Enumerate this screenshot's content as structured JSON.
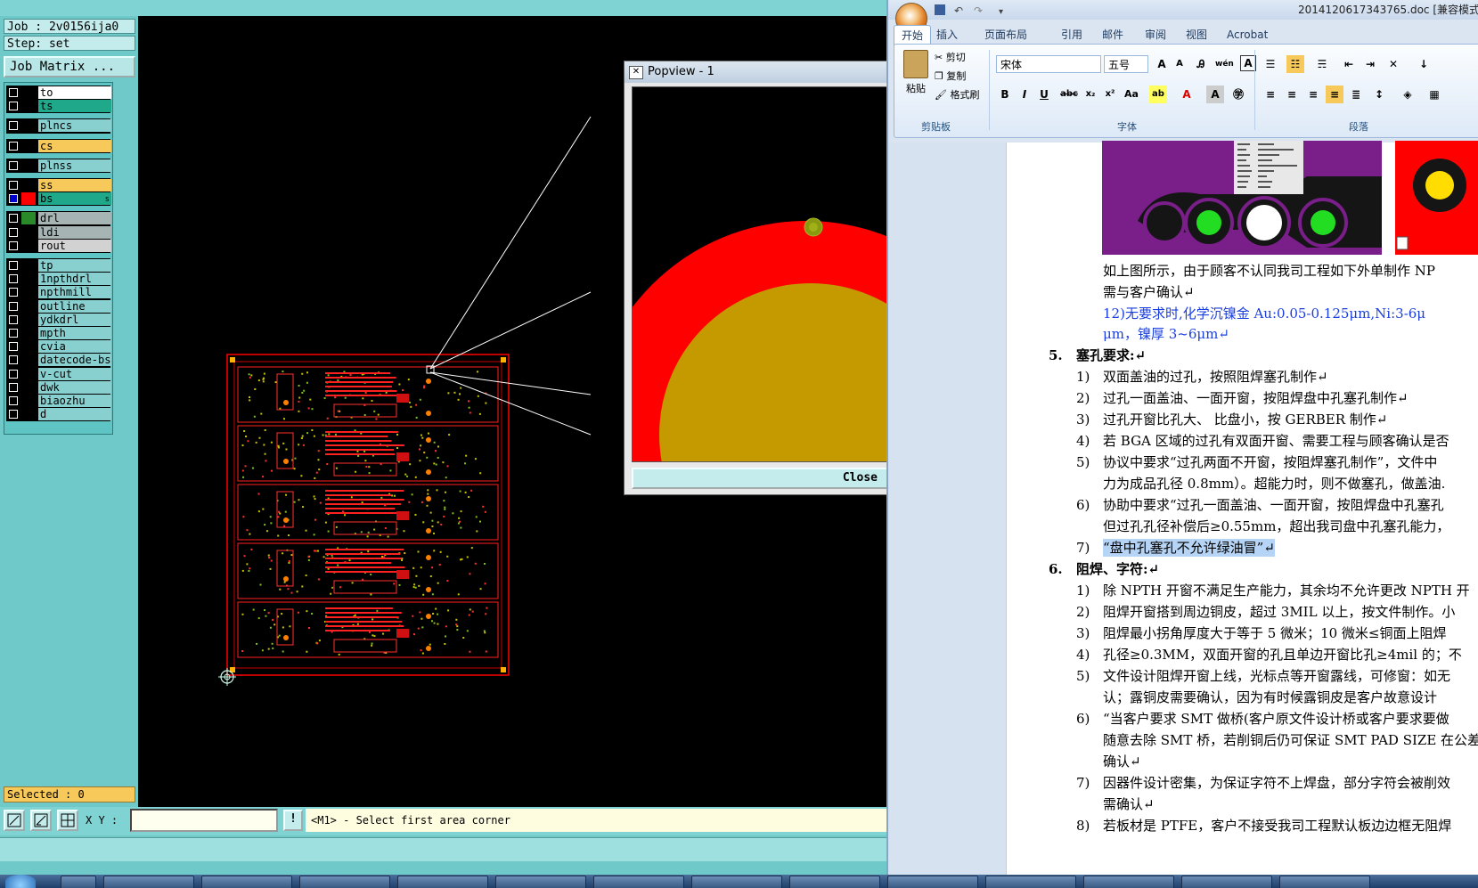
{
  "cam": {
    "job_text": "Job : 2v0156ija0",
    "step_text": "Step: set",
    "job_matrix_label": "Job Matrix ...",
    "selected_text": "Selected : 0",
    "xy_label": "X Y :",
    "xy_value": "",
    "info_button": "!",
    "prompt_text": "<M1> - Select first area corner",
    "layers": [
      {
        "name": "to",
        "swatch": "#000000",
        "color": "#ffffff"
      },
      {
        "name": "ts",
        "swatch": "#000000",
        "color": "#20a88a"
      },
      {
        "name": "plncs",
        "swatch": "#000000",
        "color": "#88d0d0"
      },
      {
        "name": "cs",
        "swatch": "#000000",
        "color": "#f7c95a"
      },
      {
        "name": "plnss",
        "swatch": "#000000",
        "color": "#88d0d0"
      },
      {
        "name": "ss",
        "swatch": "#000000",
        "color": "#f7c95a"
      },
      {
        "name": "bs",
        "swatch": "#ff0000",
        "color": "#20a88a",
        "badge": "s"
      },
      {
        "name": "drl",
        "swatch": "#2a8a2a",
        "color": "#a6b4b4"
      },
      {
        "name": "ldi",
        "swatch": "#000000",
        "color": "#a6b4b4"
      },
      {
        "name": "rout",
        "swatch": "#000000",
        "color": "#d2d2d2"
      },
      {
        "name": "tp",
        "swatch": "#000000",
        "color": "#88d0d0"
      },
      {
        "name": "1npthdrl",
        "swatch": "#000000",
        "color": "#88d0d0"
      },
      {
        "name": "npthmill",
        "swatch": "#000000",
        "color": "#88d0d0"
      },
      {
        "name": "outline",
        "swatch": "#000000",
        "color": "#88d0d0"
      },
      {
        "name": "ydkdrl",
        "swatch": "#000000",
        "color": "#88d0d0"
      },
      {
        "name": "mpth",
        "swatch": "#000000",
        "color": "#88d0d0"
      },
      {
        "name": "cvia",
        "swatch": "#000000",
        "color": "#88d0d0"
      },
      {
        "name": "datecode-bs",
        "swatch": "#000000",
        "color": "#88d0d0"
      },
      {
        "name": "v-cut",
        "swatch": "#000000",
        "color": "#88d0d0"
      },
      {
        "name": "dwk",
        "swatch": "#000000",
        "color": "#88d0d0"
      },
      {
        "name": "biaozhu",
        "swatch": "#000000",
        "color": "#88d0d0"
      },
      {
        "name": "d",
        "swatch": "#000000",
        "color": "#88d0d0"
      }
    ]
  },
  "popview": {
    "title": "Popview - 1",
    "close_label": "Close"
  },
  "word": {
    "doc_title": "2014120617343765.doc [兼容模式",
    "tabs": [
      "开始",
      "插入",
      "页面布局",
      "引用",
      "邮件",
      "审阅",
      "视图",
      "Acrobat"
    ],
    "ribbon": {
      "paste": "粘贴",
      "cut": "剪切",
      "copy": "复制",
      "format_painter": "格式刷",
      "clipboard_group": "剪贴板",
      "font_name": "宋体",
      "font_size": "五号",
      "font_group": "字体",
      "paragraph_group": "段落"
    },
    "lines": [
      {
        "text": "如上图所示，由于顾客不认同我司工程如下外单制作 NP",
        "cls": ""
      },
      {
        "text": "需与客户确认↵",
        "cls": ""
      },
      {
        "text": "12)无要求时,化学沉镍金 Au:0.05-0.125μm,Ni:3-6μ",
        "cls": "blue"
      },
      {
        "text": "μm，镍厚 3~6μm↵",
        "cls": "blue"
      },
      {
        "num": "5.",
        "text": "塞孔要求:↵",
        "cls": "bold"
      },
      {
        "num": "1)",
        "text": "双面盖油的过孔，按照阻焊塞孔制作↵",
        "cls": ""
      },
      {
        "num": "2)",
        "text": "过孔一面盖油、一面开窗，按阻焊盘中孔塞孔制作↵",
        "cls": ""
      },
      {
        "num": "3)",
        "text": "过孔开窗比孔大、 比盘小，按 GERBER 制作↵",
        "cls": ""
      },
      {
        "num": "4)",
        "text": "若 BGA 区域的过孔有双面开窗、需要工程与顾客确认是否",
        "cls": ""
      },
      {
        "num": "5)",
        "text": "协议中要求“过孔两面不开窗，按阻焊塞孔制作”，文件中",
        "cls": ""
      },
      {
        "text": "力为成品孔径 0.8mm）。超能力时，则不做塞孔，做盖油.",
        "cls": ""
      },
      {
        "num": "6)",
        "text": "协助中要求“过孔一面盖油、一面开窗，按阻焊盘中孔塞孔",
        "cls": ""
      },
      {
        "text": "但过孔孔径补偿后≥0.55mm，超出我司盘中孔塞孔能力，",
        "cls": ""
      },
      {
        "num": "7)",
        "text": "“盘中孔塞孔不允许绿油冒”↵",
        "cls": "hl"
      },
      {
        "num": "6.",
        "text": "阻焊、字符:↵",
        "cls": "bold"
      },
      {
        "num": "1)",
        "text": "除 NPTH 开窗不满足生产能力，其余均不允许更改 NPTH 开",
        "cls": ""
      },
      {
        "num": "2)",
        "text": "阻焊开窗搭到周边铜皮，超过 3MIL 以上，按文件制作。小",
        "cls": ""
      },
      {
        "num": "3)",
        "text": "阻焊最小拐角厚度大于等于 5 微米；10 微米≤铜面上阻焊",
        "cls": ""
      },
      {
        "num": "4)",
        "text": "孔径≥0.3MM，双面开窗的孔且单边开窗比孔≥4mil 的；不",
        "cls": ""
      },
      {
        "num": "5)",
        "text": "文件设计阻焊开窗上线，光标点等开窗露线，可修窗：如无",
        "cls": ""
      },
      {
        "text": "认；露铜皮需要确认，因为有时候露铜皮是客户故意设计",
        "cls": ""
      },
      {
        "num": "6)",
        "text": "“当客户要求 SMT 做桥(客户原文件设计桥或客户要求要做",
        "cls": ""
      },
      {
        "text": "随意去除 SMT 桥，若削铜后仍可保证 SMT PAD SIZE 在公差",
        "cls": ""
      },
      {
        "text": "确认↵",
        "cls": ""
      },
      {
        "num": "7)",
        "text": "因器件设计密集，为保证字符不上焊盘，部分字符会被削效",
        "cls": ""
      },
      {
        "text": "需确认↵",
        "cls": ""
      },
      {
        "num": "8)",
        "text": "若板材是 PTFE，客户不接受我司工程默认板边边框无阻焊",
        "cls": ""
      }
    ]
  }
}
